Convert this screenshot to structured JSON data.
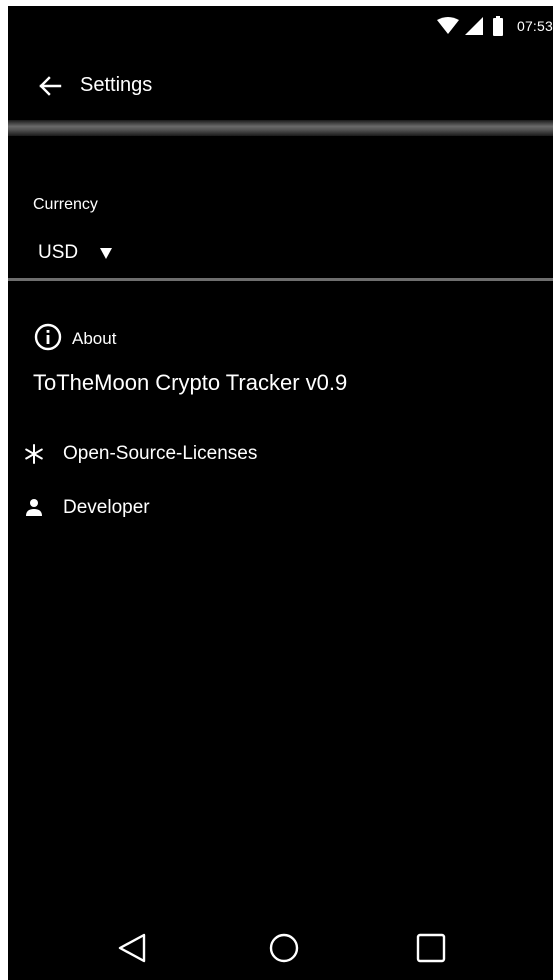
{
  "status_bar": {
    "time": "07:53",
    "icons": [
      "wifi-icon",
      "signal-icon",
      "battery-icon"
    ]
  },
  "toolbar": {
    "back_icon": "arrow-back-icon",
    "title": "Settings"
  },
  "currency": {
    "label": "Currency",
    "selected": "USD",
    "arrow_icon": "dropdown-arrow-icon"
  },
  "about": {
    "icon": "info-icon",
    "label": "About",
    "app_version": "ToTheMoon Crypto Tracker v0.9"
  },
  "items": [
    {
      "icon": "asterisk-icon",
      "label": "Open-Source-Licenses"
    },
    {
      "icon": "person-icon",
      "label": "Developer"
    }
  ],
  "nav_bar": {
    "icons": [
      "nav-back-icon",
      "nav-home-icon",
      "nav-recents-icon"
    ]
  },
  "colors": {
    "background": "#000000",
    "text": "#ffffff",
    "divider": "#6e6e6e"
  }
}
